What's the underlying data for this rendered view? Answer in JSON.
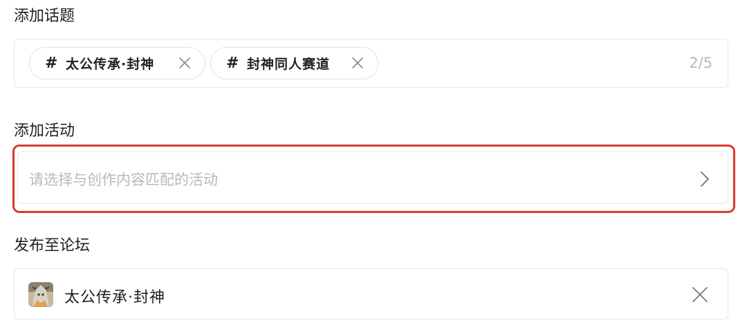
{
  "topics": {
    "label": "添加话题",
    "tags": [
      {
        "hash": "#",
        "text": "太公传承·封神"
      },
      {
        "hash": "#",
        "text": "封神同人赛道"
      }
    ],
    "counter": "2/5"
  },
  "activity": {
    "label": "添加活动",
    "placeholder": "请选择与创作内容匹配的活动",
    "highlight_color": "#d93a2f"
  },
  "forum": {
    "label": "发布至论坛",
    "name": "太公传承·封神"
  },
  "icons": {
    "tag_close": "close-icon",
    "activity_chevron": "chevron-right-icon",
    "forum_close": "close-icon",
    "forum_avatar": "forum-avatar"
  }
}
